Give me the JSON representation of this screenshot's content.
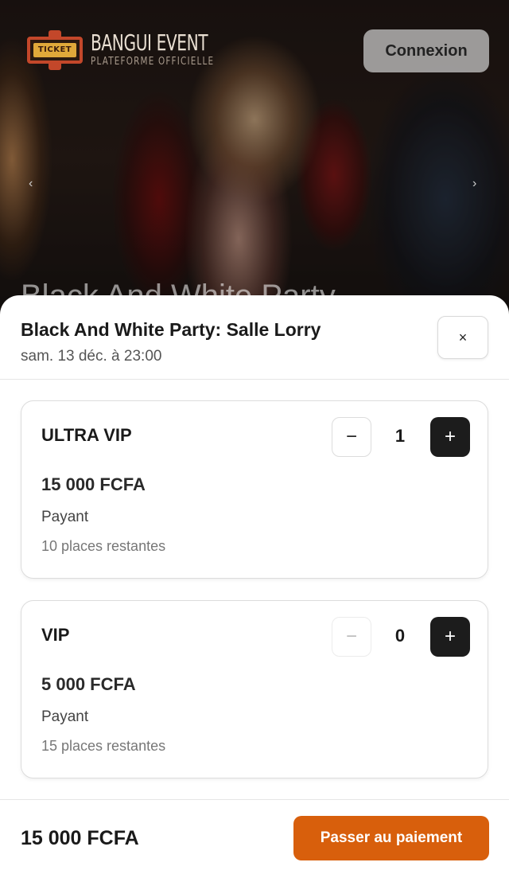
{
  "header": {
    "logo_badge_text": "TICKET",
    "logo_title": "BANGUI EVENT",
    "logo_subtitle": "PLATEFORME OFFICIELLE",
    "login_label": "Connexion",
    "carousel_prev": "‹",
    "carousel_next": "›",
    "hero_caption": "Black And White Party"
  },
  "sheet": {
    "event_title": "Black And White Party: Salle Lorry",
    "event_date": "sam. 13 déc. à 23:00",
    "close_label": "×",
    "tickets": [
      {
        "name": "ULTRA VIP",
        "price": "15 000 FCFA",
        "type": "Payant",
        "remaining": "10 places restantes",
        "quantity": "1",
        "minus_label": "−",
        "plus_label": "+"
      },
      {
        "name": "VIP",
        "price": "5 000 FCFA",
        "type": "Payant",
        "remaining": "15 places restantes",
        "quantity": "0",
        "minus_label": "−",
        "plus_label": "+"
      }
    ],
    "total": "15 000 FCFA",
    "pay_label": "Passer au paiement"
  },
  "colors": {
    "accent": "#d85f0c",
    "dark_button": "#1c1c1c"
  }
}
